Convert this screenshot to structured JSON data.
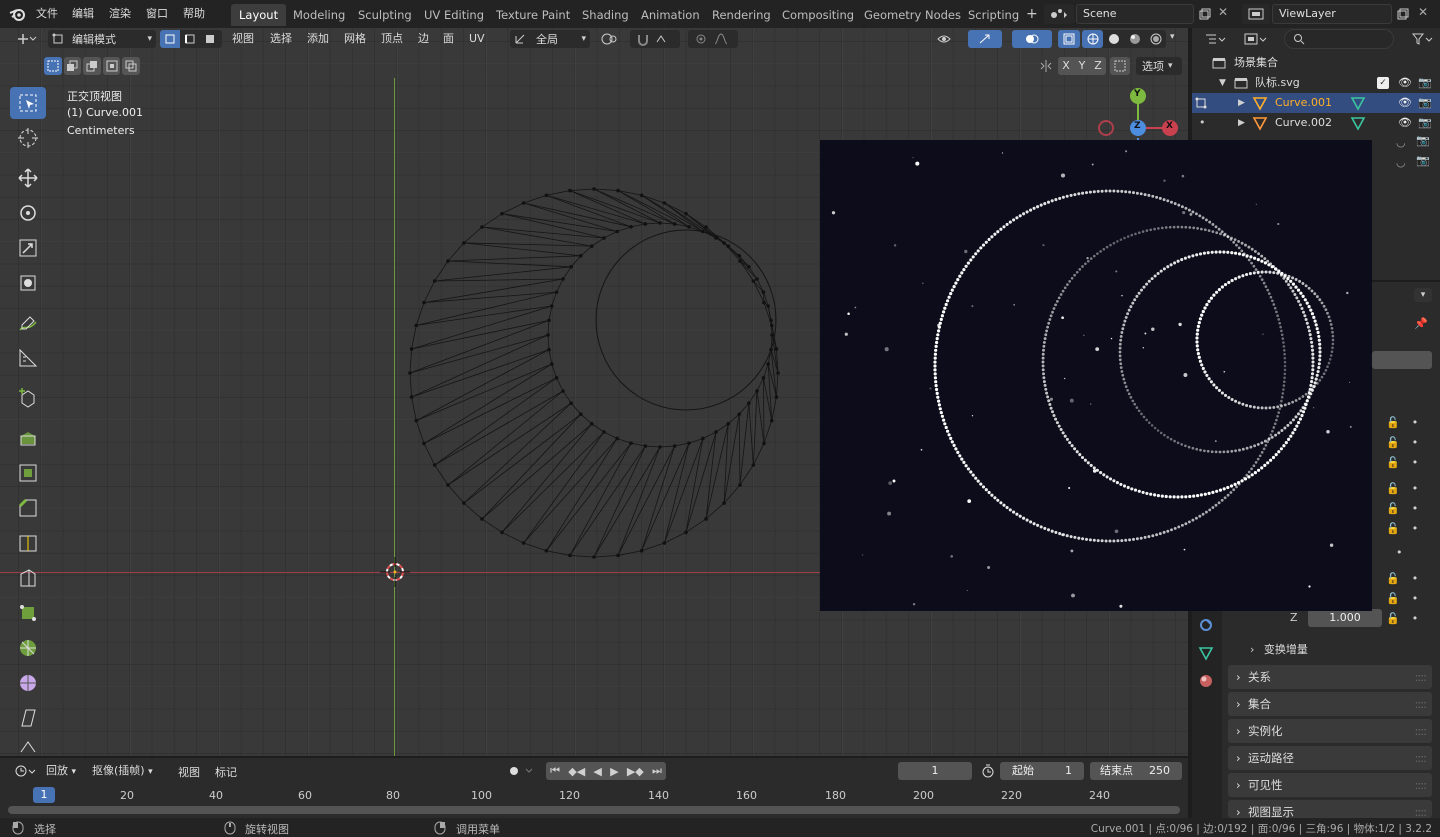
{
  "menubar": {
    "items": [
      "文件",
      "编辑",
      "渲染",
      "窗口",
      "帮助"
    ]
  },
  "workspaces": {
    "active": "Layout",
    "tabs": [
      "Layout",
      "Modeling",
      "Sculpting",
      "UV Editing",
      "Texture Paint",
      "Shading",
      "Animation",
      "Rendering",
      "Compositing",
      "Geometry Nodes",
      "Scripting"
    ],
    "add": "+"
  },
  "scene": {
    "name": "Scene",
    "view_layer": "ViewLayer"
  },
  "viewport_header": {
    "mode": "编辑模式",
    "menus": [
      "视图",
      "选择",
      "添加",
      "网格",
      "顶点",
      "边",
      "面",
      "UV"
    ],
    "transform_orientation": "全局",
    "axes": [
      "X",
      "Y",
      "Z"
    ],
    "options": "选项"
  },
  "viewport_overlay": {
    "view_name": "正交顶视图",
    "object": "(1) Curve.001",
    "units": "Centimeters"
  },
  "gizmo": {
    "y": "Y",
    "z": "Z",
    "x": "X"
  },
  "outliner": {
    "search_placeholder": "",
    "collection": "场景集合",
    "file": "队标.svg",
    "items": [
      "Curve.001",
      "Curve.002"
    ]
  },
  "properties": {
    "z_label": "Z",
    "z_value": "1.000",
    "delta_transform": "变换增量",
    "panels": [
      "关系",
      "集合",
      "实例化",
      "运动路径",
      "可见性",
      "视图显示"
    ]
  },
  "timeline": {
    "playback": "回放",
    "keying": "抠像(插帧)",
    "view": "视图",
    "marker": "标记",
    "current_frame": "1",
    "start_label": "起始",
    "start": "1",
    "end_label": "结束点",
    "end": "250",
    "ruler": [
      "1",
      "20",
      "40",
      "60",
      "80",
      "100",
      "120",
      "140",
      "160",
      "180",
      "200",
      "220",
      "240"
    ]
  },
  "statusbar": {
    "select": "选择",
    "rotate": "旋转视图",
    "menu": "调用菜单",
    "stats": "Curve.001 | 点:0/96 | 边:0/192 | 面:0/96 | 三角:96 | 物体:1/2 | 3.2.2"
  },
  "colors": {
    "accent": "#4772b3",
    "active_text": "#ffaf29",
    "x_axis": "#c9404f",
    "y_axis": "#7db93e",
    "z_axis": "#4d8de0"
  }
}
